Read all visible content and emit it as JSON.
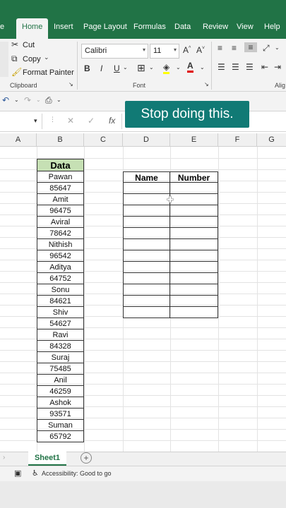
{
  "menu": {
    "file_partial": "e",
    "tabs": [
      "Home",
      "Insert",
      "Page Layout",
      "Formulas",
      "Data",
      "Review",
      "View",
      "Help"
    ]
  },
  "ribbon": {
    "cut": "Cut",
    "copy": "Copy",
    "format_painter": "Format Painter",
    "clipboard_label": "Clipboard",
    "font_name": "Calibri",
    "font_size": "11",
    "font_label": "Font",
    "alignment_partial": "Alig",
    "bold": "B",
    "italic": "I",
    "underline": "U",
    "grow_font": "A^",
    "shrink_font": "A˅"
  },
  "formula_bar": {
    "cancel": "✕",
    "enter": "✓",
    "fx": "fx"
  },
  "callout": "Stop doing this.",
  "columns": [
    "A",
    "B",
    "C",
    "D",
    "E",
    "F",
    "G"
  ],
  "data_column": {
    "header": "Data",
    "values": [
      "Pawan",
      "85647",
      "Amit",
      "96475",
      "Aviral",
      "78642",
      "Nithish",
      "96542",
      "Aditya",
      "64752",
      "Sonu",
      "84621",
      "Shiv",
      "54627",
      "Ravi",
      "84328",
      "Suraj",
      "75485",
      "Anil",
      "46259",
      "Ashok",
      "93571",
      "Suman",
      "65792"
    ]
  },
  "target_table": {
    "headers": [
      "Name",
      "Number"
    ],
    "empty_rows": 12
  },
  "sheet": {
    "tab": "Sheet1",
    "add": "+"
  },
  "status": {
    "accessibility": "Accessibility: Good to go"
  },
  "colors": {
    "excel_green": "#217346",
    "header_fill": "#c6e0b4",
    "callout": "#117a75"
  }
}
